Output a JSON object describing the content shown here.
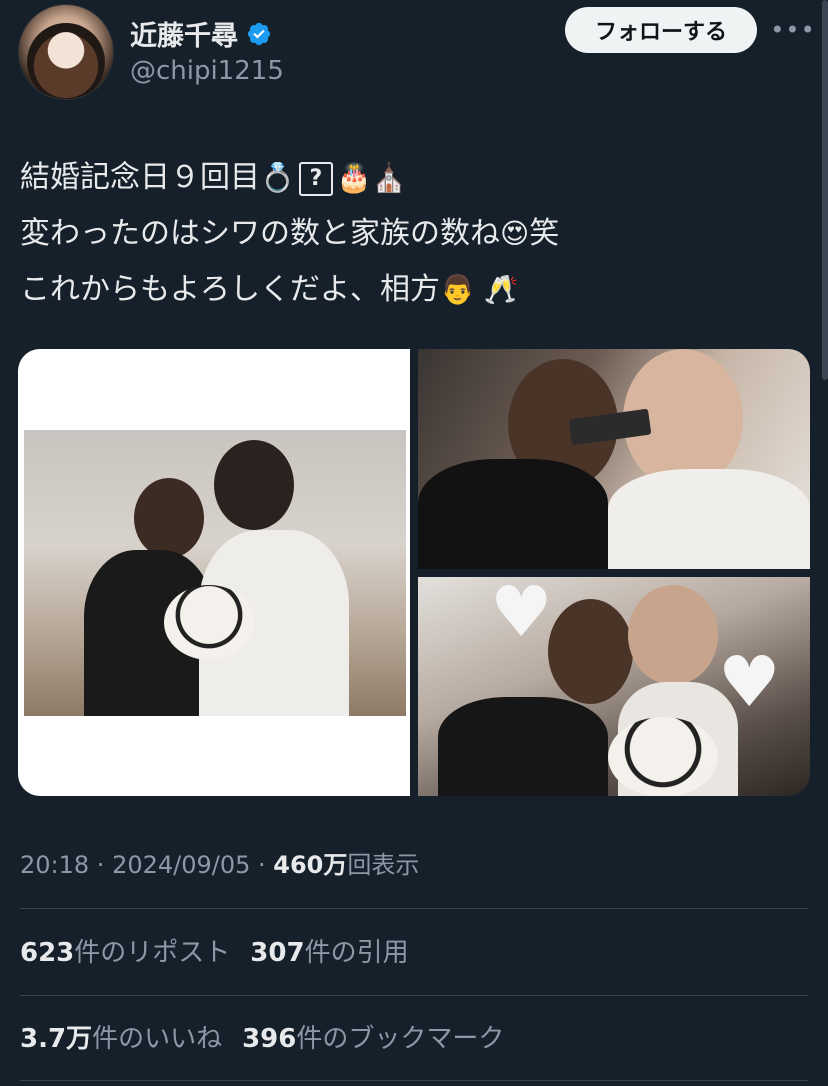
{
  "user": {
    "display_name": "近藤千尋",
    "handle": "@chipi1215",
    "verified": true
  },
  "actions": {
    "follow_label": "フォローする",
    "more_label": "•••"
  },
  "tweet": {
    "line1_text": "結婚記念日９回目",
    "line1_emojis": "💍",
    "line1_box": "?",
    "line1_emojis2": "🎂⛪",
    "line2_text": "変わったのはシワの数と家族の数ね",
    "line2_emoji": "😍",
    "line2_tail": "笑",
    "line3_text": "これからもよろしくだよ、相方",
    "line3_emojis": "👨 🥂"
  },
  "meta": {
    "time": "20:18",
    "sep1": " · ",
    "date": "2024/09/05",
    "sep2": " · ",
    "views_num": "460万",
    "views_label": "回表示"
  },
  "stats": {
    "reposts_num": "623",
    "reposts_label": "件のリポスト",
    "quotes_num": "307",
    "quotes_label": "件の引用",
    "likes_num": "3.7万",
    "likes_label": "件のいいね",
    "bookmarks_num": "396",
    "bookmarks_label": "件のブックマーク"
  },
  "colors": {
    "background": "#15202b",
    "text": "#e7e9ea",
    "secondary": "#8b98a5",
    "verified": "#1d9bf0"
  },
  "icons": [
    "verified-badge-icon",
    "more-options-icon"
  ]
}
